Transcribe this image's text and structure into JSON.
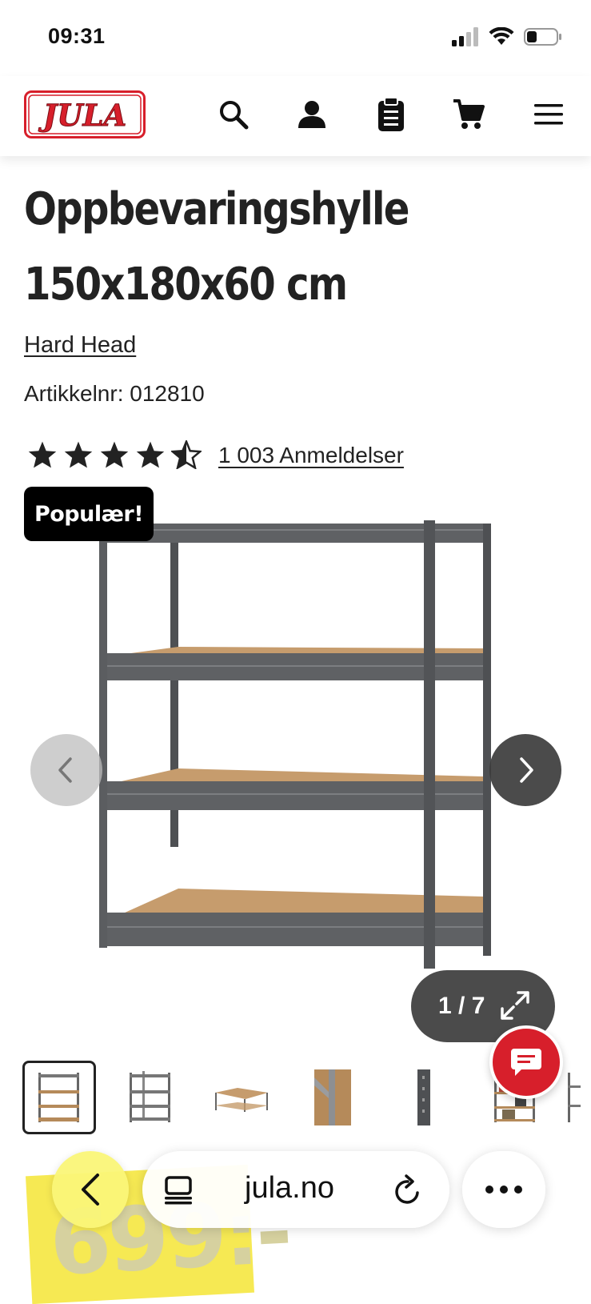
{
  "status": {
    "time": "09:31"
  },
  "header": {
    "logo_text": "JULA",
    "icons": [
      "search-icon",
      "account-icon",
      "clipboard-icon",
      "cart-icon",
      "menu-icon"
    ]
  },
  "product": {
    "title_line1": "Oppbevaringshylle",
    "title_line2": "150x180x60 cm",
    "brand": "Hard Head",
    "article_label": "Artikkelnr:",
    "article_number": "012810",
    "rating": 4.5,
    "rating_max": 5,
    "reviews_text": "1 003 Anmeldelser",
    "badge": "Populær!"
  },
  "gallery": {
    "counter": "1 / 7",
    "current": 1,
    "total": 7
  },
  "price": {
    "text": "699:-"
  },
  "browser": {
    "url": "jula.no"
  },
  "colors": {
    "brand_red": "#d71f2b",
    "shelf_metal": "#5b5d60",
    "shelf_board": "#c69c6d",
    "price_yellow": "#f6e84a"
  }
}
